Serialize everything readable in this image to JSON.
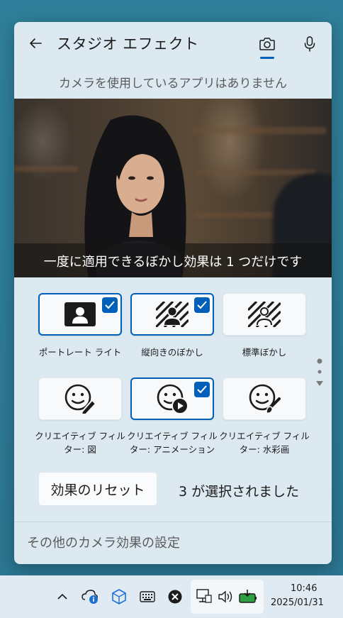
{
  "window": {
    "title": "スタジオ エフェクト",
    "status_text": "カメラを使用しているアプリはありません",
    "tabs": [
      {
        "name": "camera",
        "icon": "camera-icon",
        "selected": true
      },
      {
        "name": "microphone",
        "icon": "microphone-icon",
        "selected": false
      }
    ]
  },
  "preview": {
    "caption": "一度に適用できるぼかし効果は 1 つだけです"
  },
  "effects": [
    {
      "label": "ポートレート ライト",
      "icon": "portrait-light-icon",
      "selected": true
    },
    {
      "label": "縦向きのぼかし",
      "icon": "portrait-blur-icon",
      "selected": true
    },
    {
      "label": "標準ぼかし",
      "icon": "standard-blur-icon",
      "selected": false
    },
    {
      "label": "クリエイティブ フィルター: 図",
      "icon": "illustrated-filter-icon",
      "selected": false
    },
    {
      "label": "クリエイティブ フィルター: アニメーション",
      "icon": "animated-filter-icon",
      "selected": true
    },
    {
      "label": "クリエイティブ フィルター: 水彩画",
      "icon": "watercolor-filter-icon",
      "selected": false
    }
  ],
  "footer": {
    "reset_label": "効果のリセット",
    "selected_count_text": "3 が選択されました",
    "more_settings": "その他のカメラ効果の設定"
  },
  "taskbar": {
    "time": "10:46",
    "date": "2025/01/31"
  },
  "colors": {
    "accent": "#005fb8",
    "panel_bg": "#dce9f1",
    "desktop_bg": "#2f7f9a"
  }
}
